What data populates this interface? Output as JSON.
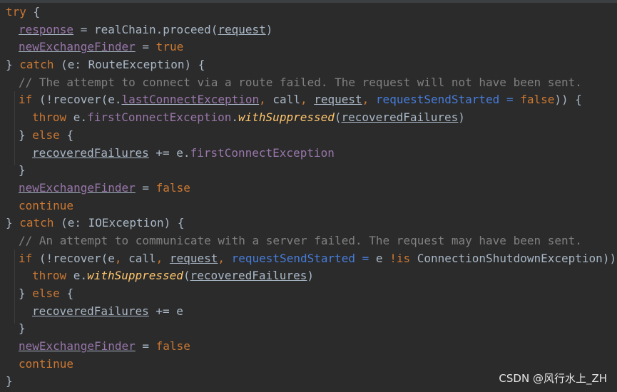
{
  "editor": {
    "tokens": {
      "try": "try",
      "brace_open": " {",
      "response": "response",
      "eq_realchain": " = realChain.proceed(",
      "request": "request",
      "close_paren": ")",
      "newExchangeFinder": "newExchangeFinder",
      "eq": " = ",
      "true": "true",
      "false": "false",
      "close_brace": "}",
      "catch": "catch",
      "route_exc": " (e: RouteException) {",
      "comment1": "// The attempt to connect via a route failed. The request will not have been sent.",
      "if": "if",
      "recover_open": " (!recover(e.",
      "lastConnectException": "lastConnectException",
      "comma_call": ", call, ",
      "comma": ", ",
      "requestSendStarted": "requestSendStarted",
      "eq_false_close": "false",
      "close_if": ")) {",
      "throw": "throw",
      "e_dot": " e.",
      "firstConnectException": "firstConnectException",
      "dot": ".",
      "withSuppressed": "withSuppressed",
      "open_paren": "(",
      "recoveredFailures": "recoveredFailures",
      "else": "else",
      "plus_eq_e_dot": " += e.",
      "continue": "continue",
      "io_exc": " (e: IOException) {",
      "comment2": "// An attempt to communicate with a server failed. The request may have been sent.",
      "e_arg": " (!recover(e, call, ",
      "eq_e": " = e ",
      "not_is": "!is",
      "conn_shutdown": " ConnectionShutdownException)) {",
      "plus_eq_e": " += e"
    }
  },
  "watermark": {
    "text": "CSDN @风行水上_ZH"
  },
  "colors": {
    "background": "#2b2b2b",
    "keyword": "#cc7832",
    "comment": "#808080",
    "property": "#9876aa",
    "named_arg": "#467cda",
    "function": "#ffc66d",
    "text": "#a9b7c6"
  }
}
